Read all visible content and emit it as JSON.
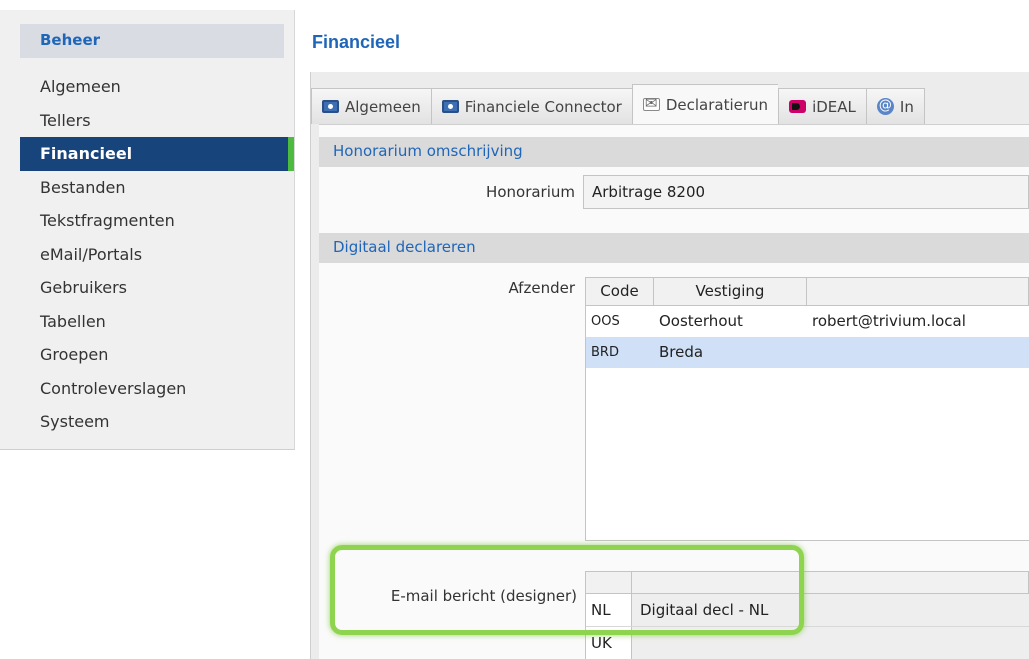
{
  "sidebar": {
    "header": "Beheer",
    "items": [
      {
        "label": "Algemeen"
      },
      {
        "label": "Tellers"
      },
      {
        "label": "Financieel"
      },
      {
        "label": "Bestanden"
      },
      {
        "label": "Tekstfragmenten"
      },
      {
        "label": "eMail/Portals"
      },
      {
        "label": "Gebruikers"
      },
      {
        "label": "Tabellen"
      },
      {
        "label": "Groepen"
      },
      {
        "label": "Controleverslagen"
      },
      {
        "label": "Systeem"
      }
    ],
    "active_item": "Financieel"
  },
  "main": {
    "title": "Financieel",
    "tabs": [
      {
        "label": "Algemeen",
        "icon": "money-icon"
      },
      {
        "label": "Financiele Connector",
        "icon": "money-icon"
      },
      {
        "label": "Declaratierun",
        "icon": "envelope-icon"
      },
      {
        "label": "iDEAL",
        "icon": "ideal-icon"
      },
      {
        "label": "In",
        "icon": "at-icon"
      }
    ],
    "active_tab": "Declaratierun",
    "sections": {
      "honorarium": {
        "header": "Honorarium omschrijving",
        "field_label": "Honorarium",
        "field_value": "Arbitrage 8200"
      },
      "digitaal": {
        "header": "Digitaal declareren",
        "afzender_label": "Afzender",
        "afzender_columns": [
          "Code",
          "Vestiging",
          ""
        ],
        "afzender_rows": [
          {
            "code": "OOS",
            "vestiging": "Oosterhout",
            "email": "robert@trivium.local"
          },
          {
            "code": "BRD",
            "vestiging": "Breda",
            "email": ""
          }
        ],
        "email_label": "E-mail bericht (designer)",
        "email_rows": [
          {
            "lang": "NL",
            "value": "Digitaal decl - NL"
          },
          {
            "lang": "UK",
            "value": ""
          }
        ]
      }
    }
  },
  "colors": {
    "accent": "#1f66b8",
    "active_sidebar": "#18447c",
    "active_marker": "#4dbb3f",
    "highlight": "#8fd44e",
    "selected_row": "#cfe0f7"
  }
}
